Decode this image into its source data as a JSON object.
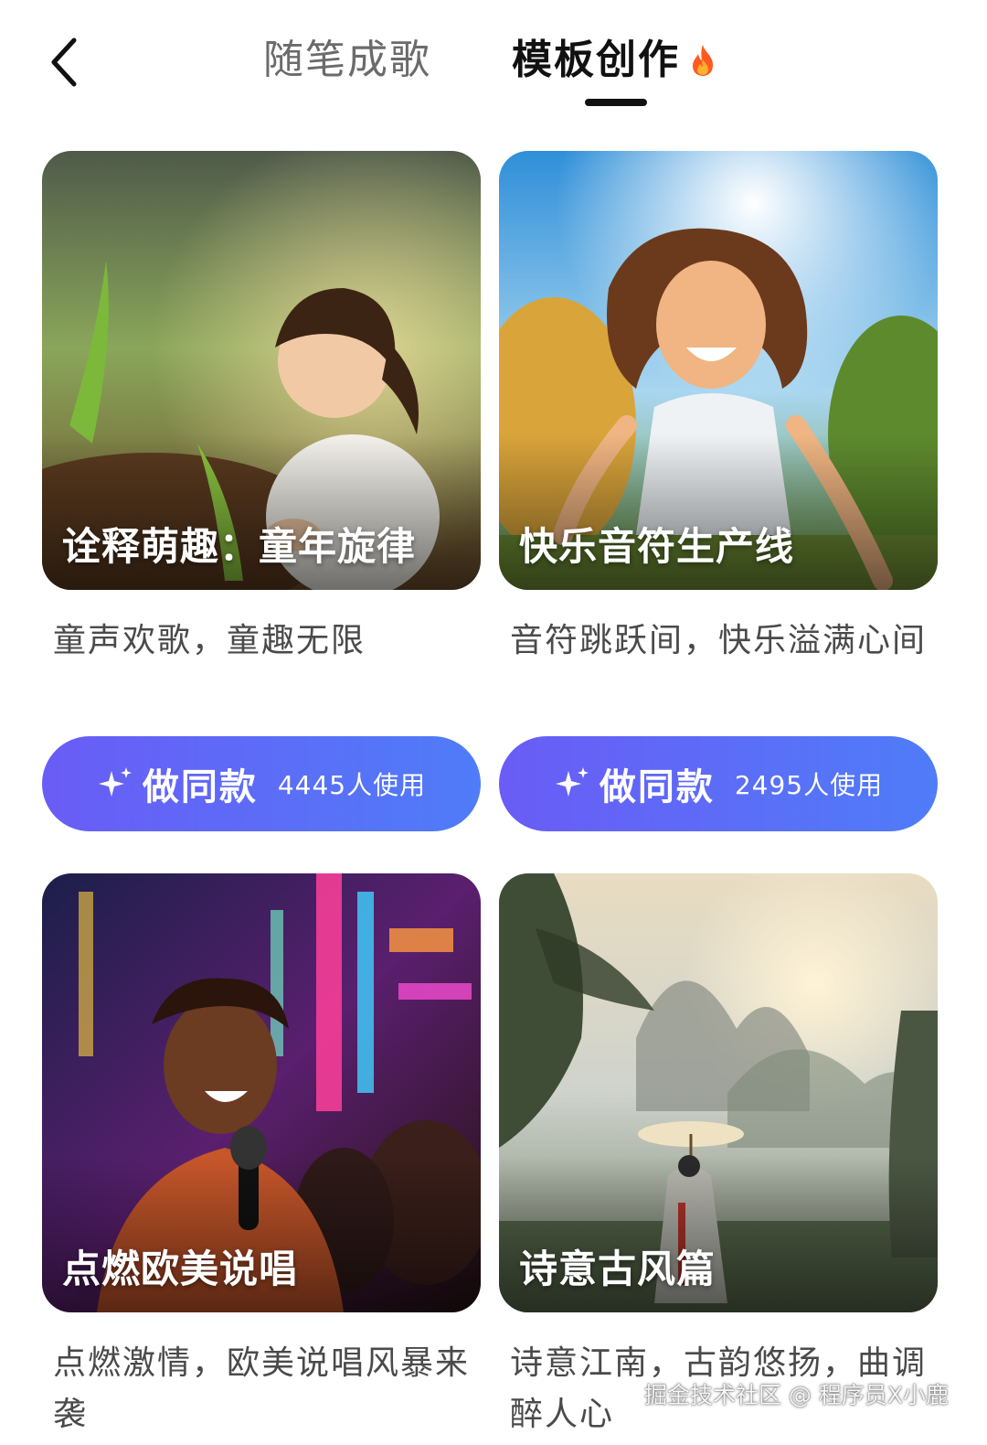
{
  "header": {
    "back_icon": "chevron-left-icon",
    "tabs": [
      {
        "label": "随笔成歌",
        "active": false
      },
      {
        "label": "模板创作",
        "active": true,
        "icon": "fire-icon"
      }
    ]
  },
  "templates": [
    {
      "title": "诠释萌趣：童年旋律",
      "description": "童声欢歌，童趣无限",
      "button_label": "做同款",
      "usage": "4445人使用"
    },
    {
      "title": "快乐音符生产线",
      "description": "音符跳跃间，快乐溢满心间",
      "button_label": "做同款",
      "usage": "2495人使用"
    },
    {
      "title": "点燃欧美说唱",
      "description": "点燃激情，欧美说唱风暴来袭"
    },
    {
      "title": "诗意古风篇",
      "description": "诗意江南，古韵悠扬，曲调醉人心"
    }
  ],
  "colors": {
    "button_gradient_start": "#6a5cf6",
    "button_gradient_end": "#4f7cf8",
    "active_tab": "#111111",
    "inactive_tab": "#6b6b6b"
  },
  "watermark": "掘金技术社区 @ 程序员X小鹿"
}
